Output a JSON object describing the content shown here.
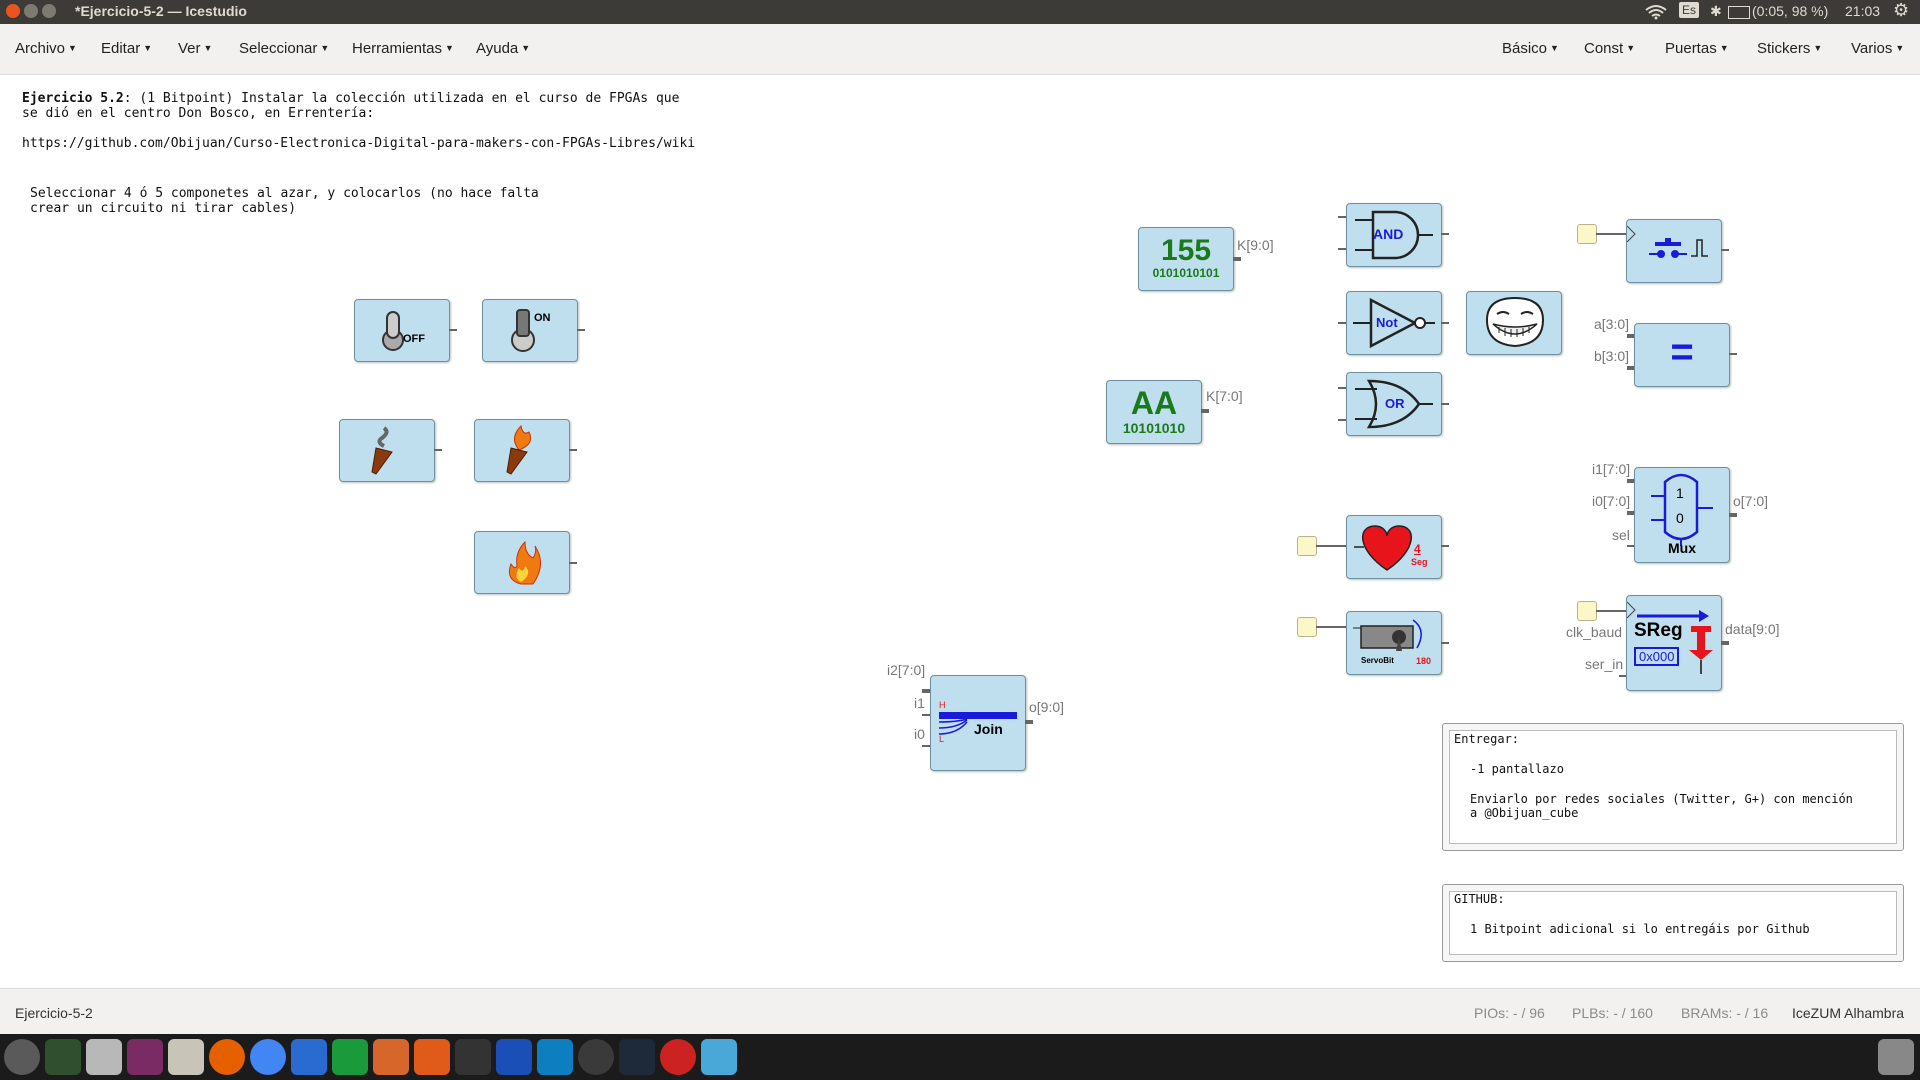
{
  "window": {
    "title": "*Ejercicio-5-2 — Icestudio"
  },
  "tray": {
    "keyboard": "Es",
    "battery": "(0:05, 98 %)",
    "clock": "21:03"
  },
  "menus_left": [
    "Archivo",
    "Editar",
    "Ver",
    "Seleccionar",
    "Herramientas",
    "Ayuda"
  ],
  "menus_right": [
    "Básico",
    "Const",
    "Puertas",
    "Stickers",
    "Varios"
  ],
  "canvas": {
    "header_bold": "Ejercicio 5.2",
    "header_rest": ": (1 Bitpoint) Instalar la colección utilizada en el curso de FPGAs que",
    "header_line2": "se dió en el centro Don Bosco, en Errentería:",
    "url": "https://github.com/Obijuan/Curso-Electronica-Digital-para-makers-con-FPGAs-Libres/wiki",
    "instr_line1": "Seleccionar 4 ó 5 componetes al azar, y colocarlos (no hace falta",
    "instr_line2": "crear un circuito ni tirar cables)"
  },
  "blocks": {
    "switch_off": {
      "label": "OFF"
    },
    "switch_on": {
      "label": "ON"
    },
    "const155": {
      "value": "155",
      "bits": "0101010101",
      "port": "K[9:0]"
    },
    "constAA": {
      "value": "AA",
      "bits": "10101010",
      "port": "K[7:0]"
    },
    "and": {
      "label": "AND"
    },
    "not": {
      "label": "Not"
    },
    "or": {
      "label": "OR"
    },
    "heart": {
      "n": "4",
      "unit": "Seg"
    },
    "servo": {
      "label": "ServoBit",
      "deg": "180"
    },
    "comparator": {
      "a": "a[3:0]",
      "b": "b[3:0]",
      "symbol": "="
    },
    "mux": {
      "i1": "i1[7:0]",
      "i0": "i0[7:0]",
      "sel": "sel",
      "out": "o[7:0]",
      "one": "1",
      "zero": "0",
      "label": "Mux"
    },
    "sreg": {
      "clk": "clk_baud",
      "ser": "ser_in",
      "out": "data[9:0]",
      "label": "SReg",
      "init": "0x000"
    },
    "join": {
      "i2": "i2[7:0]",
      "i1": "i1",
      "i0": "i0",
      "out": "o[9:0]",
      "label": "Join",
      "h": "H",
      "l": "L"
    }
  },
  "notes": {
    "entregar_title": "Entregar:",
    "entregar_item": "-1 pantallazo",
    "entregar_line1": "Enviarlo por redes sociales (Twitter, G+) con mención",
    "entregar_line2": "a @Obijuan_cube",
    "github_title": "GITHUB:",
    "github_line": "1 Bitpoint adicional si lo entregáis por Github"
  },
  "status": {
    "project": "Ejercicio-5-2",
    "pios": "PIOs:  - / 96",
    "plbs": "PLBs:  - / 160",
    "brams": "BRAMs:  - / 16",
    "board": "IceZUM Alhambra"
  },
  "colors": {
    "block_fill": "#bfdfee",
    "const_green": "#1a7a1a",
    "gate_blue": "#1a1adb",
    "heart_red": "#e8141c"
  }
}
